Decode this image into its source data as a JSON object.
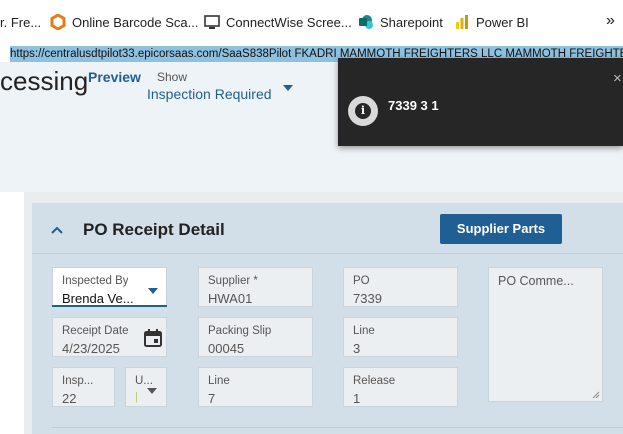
{
  "bookmarks": [
    {
      "label": "r. Fre..."
    },
    {
      "label": "Online Barcode Sca..."
    },
    {
      "label": "ConnectWise Scree..."
    },
    {
      "label": "Sharepoint"
    },
    {
      "label": "Power BI"
    }
  ],
  "overflow": "»",
  "url_banner": "https://centralusdtpilot33.epicorsaas.com/SaaS838Pilot   FKADRI   MAMMOTH FREIGHTERS LLC   MAMMOTH FREIGHTERS",
  "header": {
    "title_fragment": "cessing",
    "preview_label": "Preview",
    "show_label": "Show",
    "show_value": "Inspection Required"
  },
  "card": {
    "title": "PO Receipt Detail",
    "collapse_glyph": "^",
    "supplier_parts_label": "Supplier Parts",
    "fields": {
      "inspected_by": {
        "label": "Inspected By",
        "value": "Brenda Ve..."
      },
      "supplier": {
        "label": "Supplier *",
        "value": "HWA01"
      },
      "po": {
        "label": "PO",
        "value": "7339"
      },
      "po_comment": {
        "label": "PO Comme..."
      },
      "receipt_date": {
        "label": "Receipt Date",
        "value": "4/23/2025"
      },
      "packing_slip": {
        "label": "Packing Slip",
        "value": "00045"
      },
      "line_po": {
        "label": "Line",
        "value": "3"
      },
      "insp": {
        "label": "Insp...",
        "value": "22"
      },
      "uom": {
        "label": "U...",
        "value": "|"
      },
      "line_ps": {
        "label": "Line",
        "value": "7"
      },
      "release": {
        "label": "Release",
        "value": "1"
      }
    }
  },
  "toast": {
    "message": "7339 3 1",
    "close_glyph": "×",
    "info_glyph": "i"
  },
  "colors": {
    "accent": "#1f5f93",
    "toast_bg": "#262626",
    "url_banner": "#8ec1e0"
  }
}
